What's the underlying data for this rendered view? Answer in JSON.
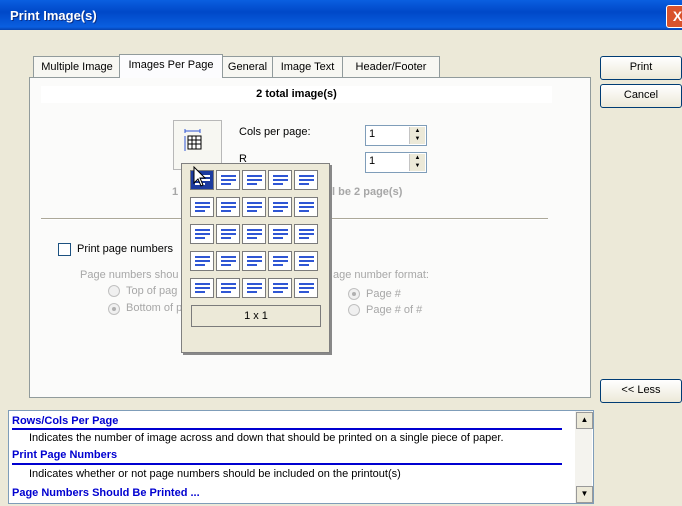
{
  "window": {
    "title": "Print Image(s)",
    "close_glyph": "X"
  },
  "buttons": {
    "print": "Print",
    "cancel": "Cancel",
    "less": "<< Less"
  },
  "tabs": [
    {
      "label": "Multiple Image",
      "active": false
    },
    {
      "label": "Images Per Page",
      "active": true
    },
    {
      "label": "General",
      "active": false
    },
    {
      "label": "Image Text",
      "active": false
    },
    {
      "label": "Header/Footer",
      "active": false
    }
  ],
  "images_per_page": {
    "total": "2 total image(s)",
    "cols_label": "Cols per page:",
    "cols_value": "1",
    "rows_label": "R",
    "rows_value": "1",
    "pages_fragment_left": "1",
    "pages_fragment_right": "ll be 2 page(s)",
    "grid_selection": "1 x 1",
    "grid_rows": 5,
    "grid_cols": 5
  },
  "page_numbers": {
    "checkbox_label": "Print page numbers",
    "checked": false,
    "position_label": "Page numbers shou",
    "position_options": [
      {
        "label": "Top of pag",
        "selected": false
      },
      {
        "label": "Bottom of p",
        "selected": true
      }
    ],
    "format_label": "age number format:",
    "format_options": [
      {
        "label": "Page #",
        "selected": true
      },
      {
        "label": "Page # of #",
        "selected": false
      }
    ]
  },
  "help": [
    {
      "heading": "Rows/Cols Per Page",
      "text": "Indicates the number of image across and down that should be printed on a single piece of paper."
    },
    {
      "heading": "Print Page Numbers",
      "text": "Indicates whether or not page numbers should be included on the printout(s)"
    },
    {
      "heading": "Page Numbers Should Be Printed ...",
      "text": ""
    }
  ],
  "colors": {
    "title_bar": "#0a5fe0",
    "help_heading": "#0000d0",
    "grid_selected": "#1c3b9f"
  }
}
